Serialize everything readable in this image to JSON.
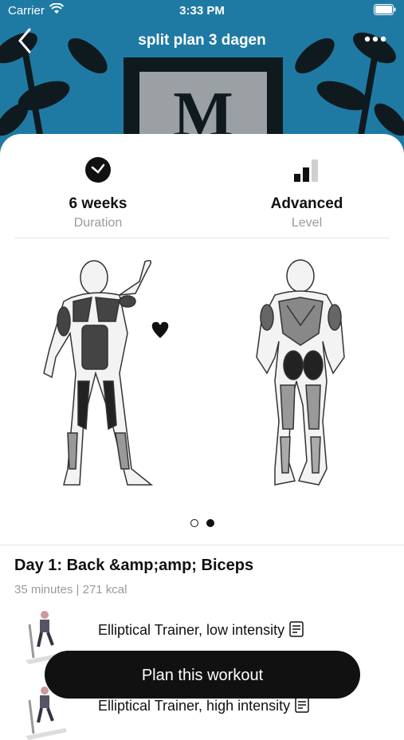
{
  "status_bar": {
    "carrier": "Carrier",
    "time": "3:33 PM"
  },
  "nav": {
    "title": "split plan 3 dagen",
    "back_icon": "chevron-left-icon",
    "more_icon": "more-horizontal-icon"
  },
  "hero": {
    "logo_letter": "M"
  },
  "stats": [
    {
      "value": "6 weeks",
      "label": "Duration",
      "icon": "clock-icon"
    },
    {
      "value": "Advanced",
      "label": "Level",
      "icon": "level-bars-icon"
    }
  ],
  "carousel": {
    "pages": 2,
    "current_page": 2
  },
  "day": {
    "title": "Day 1: Back &amp;amp; Biceps",
    "meta": "35 minutes | 271 kcal"
  },
  "exercises": [
    {
      "name": "Elliptical Trainer, low intensity",
      "icon": "note-icon"
    },
    {
      "name": "Elliptical Trainer, high intensity",
      "icon": "note-icon"
    }
  ],
  "cta": {
    "label": "Plan this workout"
  },
  "colors": {
    "hero": "#1f7aa3",
    "primary": "#111111",
    "muted": "#9a9a9a"
  }
}
